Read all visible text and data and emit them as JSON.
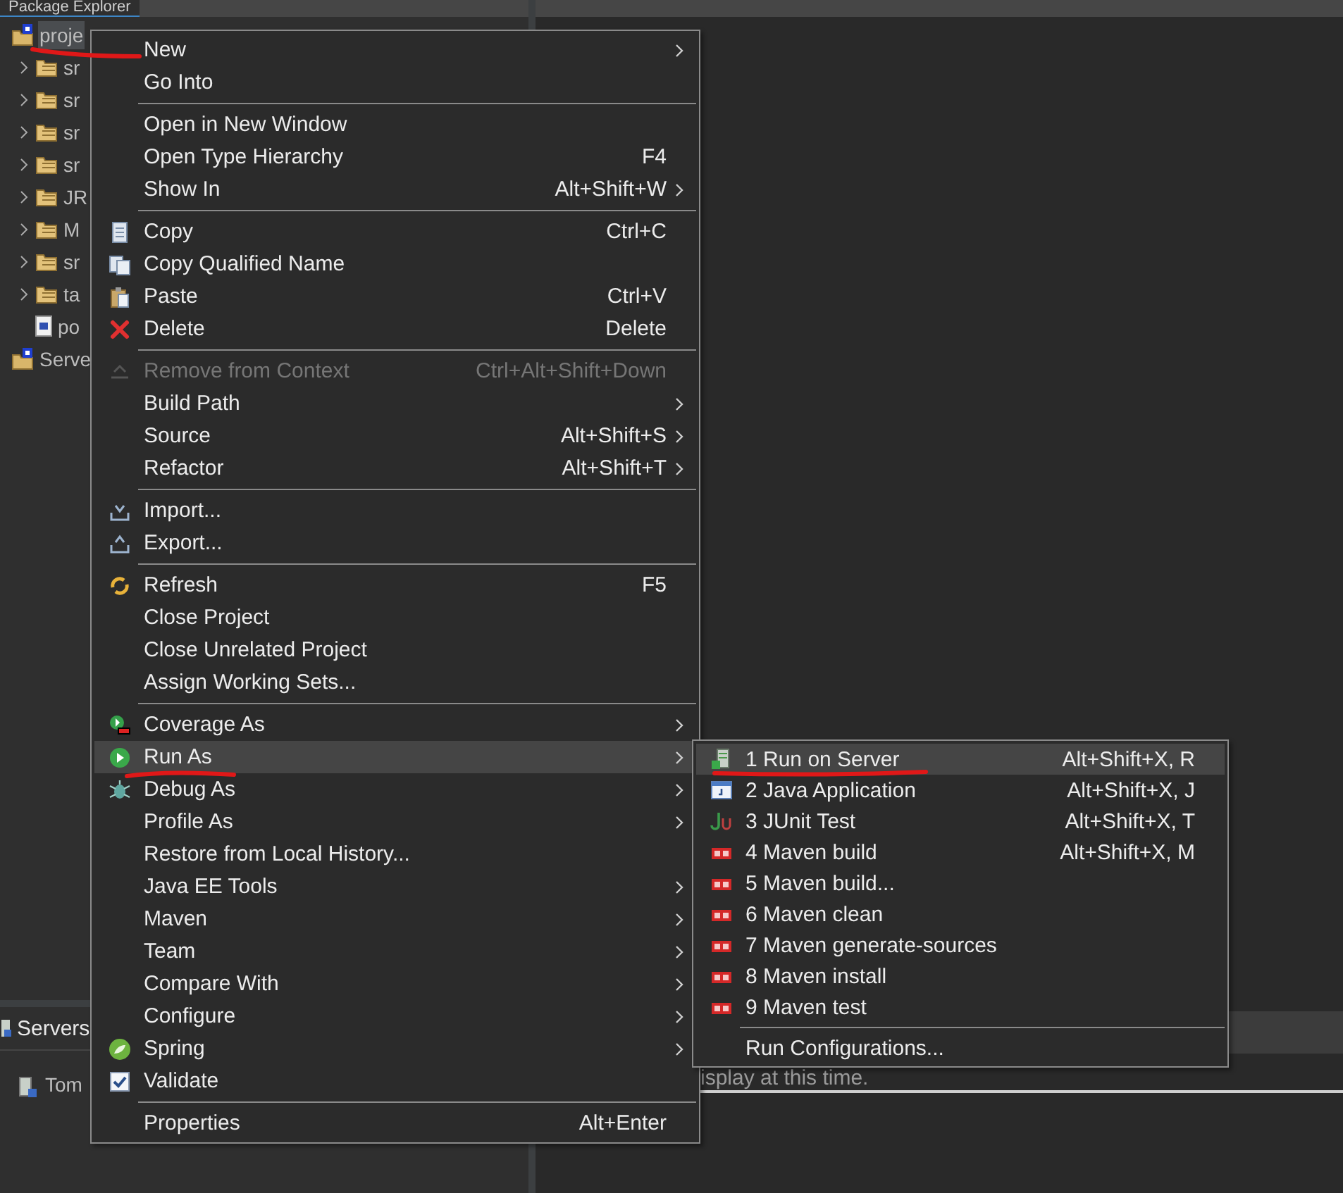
{
  "left_panel": {
    "tab": "Package Explorer",
    "tree": [
      {
        "label": "proje",
        "selected": true,
        "children": [
          {
            "label": "sr",
            "expandable": true
          },
          {
            "label": "sr",
            "expandable": true
          },
          {
            "label": "sr",
            "expandable": true
          },
          {
            "label": "sr",
            "expandable": true
          },
          {
            "label": "JR",
            "expandable": true
          },
          {
            "label": "M",
            "expandable": true
          },
          {
            "label": "sr",
            "expandable": true
          },
          {
            "label": "ta",
            "expandable": true
          },
          {
            "label": "po",
            "expandable": false
          }
        ]
      },
      {
        "label": "Serve",
        "selected": false
      }
    ]
  },
  "bottom_panel": {
    "tab": "Servers",
    "rows": [
      "Tom"
    ],
    "message": "isplay at this time."
  },
  "context_menu": {
    "groups": [
      [
        {
          "label": "New",
          "submenu": true,
          "disabled": false,
          "selected": false
        },
        {
          "label": "Go Into",
          "submenu": false,
          "disabled": false,
          "selected": false
        }
      ],
      [
        {
          "label": "Open in New Window",
          "submenu": false,
          "disabled": false,
          "selected": false
        },
        {
          "label": "Open Type Hierarchy",
          "shortcut": "F4",
          "submenu": false,
          "disabled": false,
          "selected": false
        },
        {
          "label": "Show In",
          "shortcut": "Alt+Shift+W",
          "submenu": true,
          "disabled": false,
          "selected": false
        }
      ],
      [
        {
          "label": "Copy",
          "shortcut": "Ctrl+C",
          "submenu": false,
          "disabled": false,
          "selected": false
        },
        {
          "label": "Copy Qualified Name",
          "submenu": false,
          "disabled": false,
          "selected": false
        },
        {
          "label": "Paste",
          "shortcut": "Ctrl+V",
          "submenu": false,
          "disabled": false,
          "selected": false
        },
        {
          "label": "Delete",
          "shortcut": "Delete",
          "submenu": false,
          "disabled": false,
          "selected": false
        }
      ],
      [
        {
          "label": "Remove from Context",
          "shortcut": "Ctrl+Alt+Shift+Down",
          "submenu": false,
          "disabled": true,
          "selected": false
        },
        {
          "label": "Build Path",
          "submenu": true,
          "disabled": false,
          "selected": false
        },
        {
          "label": "Source",
          "shortcut": "Alt+Shift+S",
          "submenu": true,
          "disabled": false,
          "selected": false
        },
        {
          "label": "Refactor",
          "shortcut": "Alt+Shift+T",
          "submenu": true,
          "disabled": false,
          "selected": false
        }
      ],
      [
        {
          "label": "Import...",
          "submenu": false,
          "disabled": false,
          "selected": false
        },
        {
          "label": "Export...",
          "submenu": false,
          "disabled": false,
          "selected": false
        }
      ],
      [
        {
          "label": "Refresh",
          "shortcut": "F5",
          "submenu": false,
          "disabled": false,
          "selected": false
        },
        {
          "label": "Close Project",
          "submenu": false,
          "disabled": false,
          "selected": false
        },
        {
          "label": "Close Unrelated Project",
          "submenu": false,
          "disabled": false,
          "selected": false
        },
        {
          "label": "Assign Working Sets...",
          "submenu": false,
          "disabled": false,
          "selected": false
        }
      ],
      [
        {
          "label": "Coverage As",
          "submenu": true,
          "disabled": false,
          "selected": false
        },
        {
          "label": "Run As",
          "submenu": true,
          "disabled": false,
          "selected": true
        },
        {
          "label": "Debug As",
          "submenu": true,
          "disabled": false,
          "selected": false
        },
        {
          "label": "Profile As",
          "submenu": true,
          "disabled": false,
          "selected": false
        },
        {
          "label": "Restore from Local History...",
          "submenu": false,
          "disabled": false,
          "selected": false
        },
        {
          "label": "Java EE Tools",
          "submenu": true,
          "disabled": false,
          "selected": false
        },
        {
          "label": "Maven",
          "submenu": true,
          "disabled": false,
          "selected": false
        },
        {
          "label": "Team",
          "submenu": true,
          "disabled": false,
          "selected": false
        },
        {
          "label": "Compare With",
          "submenu": true,
          "disabled": false,
          "selected": false
        },
        {
          "label": "Configure",
          "submenu": true,
          "disabled": false,
          "selected": false
        },
        {
          "label": "Spring",
          "submenu": true,
          "disabled": false,
          "selected": false
        },
        {
          "label": "Validate",
          "submenu": false,
          "disabled": false,
          "selected": false
        }
      ],
      [
        {
          "label": "Properties",
          "shortcut": "Alt+Enter",
          "submenu": false,
          "disabled": false,
          "selected": false
        }
      ]
    ]
  },
  "run_as_submenu": {
    "groups": [
      [
        {
          "label": "1 Run on Server",
          "shortcut": "Alt+Shift+X, R",
          "selected": true
        },
        {
          "label": "2 Java Application",
          "shortcut": "Alt+Shift+X, J",
          "selected": false
        },
        {
          "label": "3 JUnit Test",
          "shortcut": "Alt+Shift+X, T",
          "selected": false
        },
        {
          "label": "4 Maven build",
          "shortcut": "Alt+Shift+X, M",
          "selected": false
        },
        {
          "label": "5 Maven build...",
          "selected": false
        },
        {
          "label": "6 Maven clean",
          "selected": false
        },
        {
          "label": "7 Maven generate-sources",
          "selected": false
        },
        {
          "label": "8 Maven install",
          "selected": false
        },
        {
          "label": "9 Maven test",
          "selected": false
        }
      ],
      [
        {
          "label": "Run Configurations...",
          "selected": false
        }
      ]
    ]
  }
}
